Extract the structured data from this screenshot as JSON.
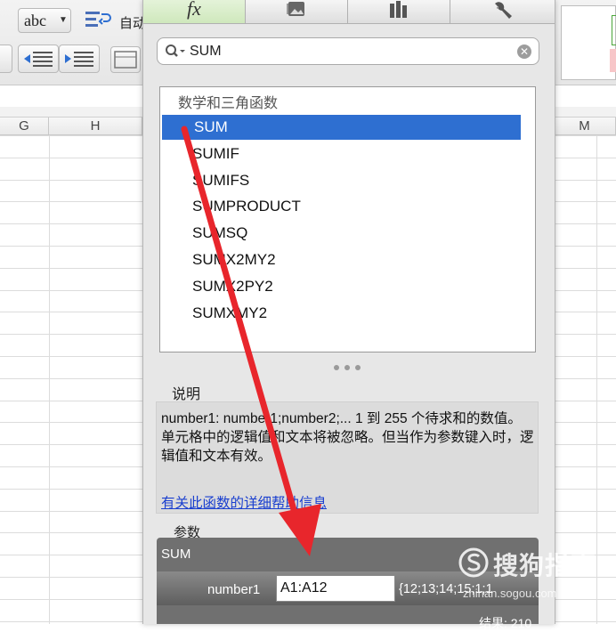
{
  "toolbar": {
    "spellcheck_label": "abc",
    "autofit_label": "自动"
  },
  "columns": [
    "G",
    "H",
    "M"
  ],
  "panel": {
    "tabs": [
      {
        "id": "functions",
        "label": "fx"
      },
      {
        "id": "media",
        "label": ""
      },
      {
        "id": "charts",
        "label": ""
      },
      {
        "id": "tools",
        "label": ""
      }
    ],
    "search": {
      "value": "SUM"
    },
    "category": "数学和三角函数",
    "functions": [
      "SUM",
      "SUMIF",
      "SUMIFS",
      "SUMPRODUCT",
      "SUMSQ",
      "SUMX2MY2",
      "SUMX2PY2",
      "SUMXMY2"
    ],
    "selected_function": "SUM",
    "description_title": "说明",
    "description": "number1: number1;number2;... 1 到 255 个待求和的数值。单元格中的逻辑值和文本将被忽略。但当作为参数键入时，逻辑值和文本有效。",
    "help_link": "有关此函数的详细帮助信息",
    "args_title": "参数",
    "args": {
      "function_name": "SUM",
      "arg_label": "number1",
      "arg_input": "A1:A12",
      "arg_value": "{12;13;14;15;1;1",
      "result": "结果: 210"
    }
  },
  "watermark": {
    "name": "搜狗指南",
    "url": "zhinan.sogou.com"
  },
  "colors": {
    "selection": "#2e6fd1",
    "arrow": "#e8262c",
    "link": "#1a3fcf"
  }
}
